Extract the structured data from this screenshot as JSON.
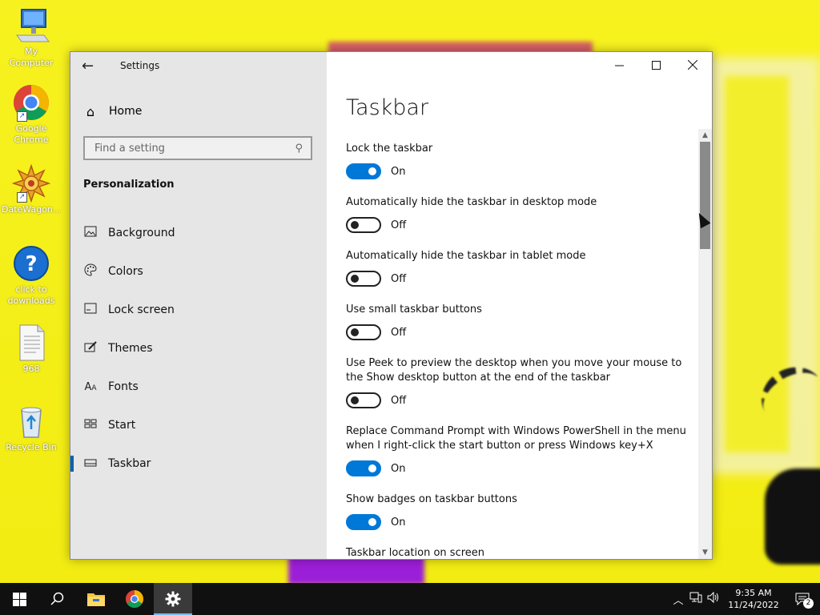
{
  "desktop": {
    "icons": [
      {
        "label": "My Computer",
        "icon": "computer-icon"
      },
      {
        "label": "Google Chrome",
        "icon": "chrome-icon"
      },
      {
        "label": "DateWagon...",
        "icon": "datewagon-icon"
      },
      {
        "label": "click to downloads",
        "icon": "help-icon"
      },
      {
        "label": "968",
        "icon": "text-file-icon"
      },
      {
        "label": "Recycle Bin",
        "icon": "recycle-bin-icon"
      }
    ]
  },
  "window": {
    "title": "Settings",
    "back_glyph": "←",
    "controls": {
      "minimize": "—",
      "maximize": "☐",
      "close": "✕"
    }
  },
  "nav": {
    "home_label": "Home",
    "search_placeholder": "Find a setting",
    "section": "Personalization",
    "items": [
      {
        "label": "Background",
        "icon": "picture-icon",
        "glyph": "🖼"
      },
      {
        "label": "Colors",
        "icon": "palette-icon",
        "glyph": "🎨"
      },
      {
        "label": "Lock screen",
        "icon": "lock-screen-icon",
        "glyph": "▭"
      },
      {
        "label": "Themes",
        "icon": "themes-icon",
        "glyph": "✎"
      },
      {
        "label": "Fonts",
        "icon": "fonts-icon",
        "glyph": "A"
      },
      {
        "label": "Start",
        "icon": "start-icon",
        "glyph": "▦"
      },
      {
        "label": "Taskbar",
        "icon": "taskbar-icon",
        "glyph": "▬",
        "active": true
      }
    ]
  },
  "content": {
    "title": "Taskbar",
    "settings": [
      {
        "label": "Lock the taskbar",
        "state": "On",
        "on": true
      },
      {
        "label": "Automatically hide the taskbar in desktop mode",
        "state": "Off",
        "on": false
      },
      {
        "label": "Automatically hide the taskbar in tablet mode",
        "state": "Off",
        "on": false
      },
      {
        "label": "Use small taskbar buttons",
        "state": "Off",
        "on": false
      },
      {
        "label": "Use Peek to preview the desktop when you move your mouse to the Show desktop button at the end of the taskbar",
        "state": "Off",
        "on": false
      },
      {
        "label": "Replace Command Prompt with Windows PowerShell in the menu when I right-click the start button or press Windows key+X",
        "state": "On",
        "on": true
      },
      {
        "label": "Show badges on taskbar buttons",
        "state": "On",
        "on": true
      }
    ],
    "location_label": "Taskbar location on screen"
  },
  "taskbar": {
    "time": "9:35 AM",
    "date": "11/24/2022",
    "notification_count": "2",
    "accent": "#0078d7"
  }
}
